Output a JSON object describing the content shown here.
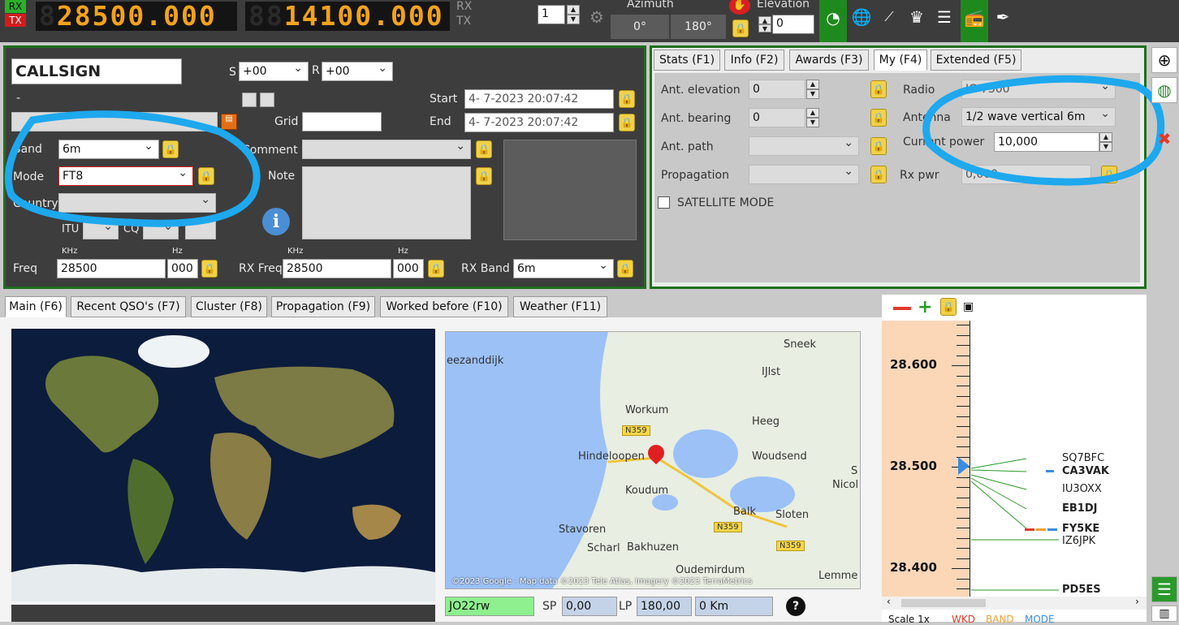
{
  "topbar": {
    "rx_tag": "RX",
    "tx_tag": "TX",
    "rx_freq": "28500.000",
    "tx_freq": "14100.000",
    "rx_label": "RX",
    "tx_label": "TX",
    "vfo_value": "1",
    "azimuth_label": "Azimuth",
    "azimuth_values": [
      "0°",
      "180°"
    ],
    "elevation_label": "Elevation",
    "elevation_value": "0"
  },
  "qso": {
    "callsign": "CALLSIGN",
    "s_label": "S",
    "s_value": "+00",
    "r_label": "R",
    "r_value": "+00",
    "dash": "-",
    "start_label": "Start",
    "start_value": "4- 7-2023 20:07:42",
    "end_label": "End",
    "end_value": "4- 7-2023 20:07:42",
    "grid_label": "Grid",
    "band_label": "Band",
    "band_value": "6m",
    "mode_label": "Mode",
    "mode_value": "FT8",
    "comment_label": "Comment",
    "note_label": "Note",
    "country_label": "Country",
    "itu_label": "ITU",
    "cq_label": "CQ",
    "khz_label": "KHz",
    "hz_label": "Hz",
    "freq_label": "Freq",
    "freq_khz": "28500",
    "freq_hz": "000",
    "rxfreq_label": "RX Freq",
    "rxfreq_khz": "28500",
    "rxfreq_hz": "000",
    "rxband_label": "RX Band",
    "rxband_value": "6m"
  },
  "my_tabs": [
    "Stats (F1)",
    "Info (F2)",
    "Awards (F3)",
    "My (F4)",
    "Extended (F5)"
  ],
  "my_panel": {
    "ant_elevation_label": "Ant. elevation",
    "ant_elevation_value": "0",
    "ant_bearing_label": "Ant. bearing",
    "ant_bearing_value": "0",
    "ant_path_label": "Ant. path",
    "propagation_label": "Propagation",
    "satellite_label": "SATELLITE MODE",
    "radio_label": "Radio",
    "radio_value": "IC-7300",
    "antenna_label": "Antenna",
    "antenna_value": "1/2 wave vertical 6m",
    "current_power_label": "Current power",
    "current_power_value": "10,000",
    "rx_pwr_label": "Rx pwr",
    "rx_pwr_value": "0,000"
  },
  "main_tabs": [
    "Main (F6)",
    "Recent QSO's (F7)",
    "Cluster (F8)",
    "Propagation (F9)",
    "Worked before (F10)",
    "Weather (F11)"
  ],
  "map": {
    "places": [
      "Sneek",
      "IJlst",
      "Workum",
      "Heeg",
      "Hindeloopen",
      "Woudsend",
      "Koudum",
      "Balk",
      "Sloten",
      "Stavoren",
      "Scharl",
      "Bakhuzen",
      "Oudemirdum",
      "Lemme",
      "Nicol",
      "eezanddijk",
      "S"
    ],
    "roads": [
      "N359",
      "N359",
      "N359"
    ],
    "copyright": "©2023 Google - Map data ©2023 Tele Atlas, Imagery ©2023 TerraMetrics",
    "locator": "JO22rw",
    "sp_label": "SP",
    "sp_value": "0,00",
    "lp_label": "LP",
    "lp_value": "180,00",
    "distance": "0 Km"
  },
  "bandmap": {
    "freqs": [
      "28.600",
      "28.500",
      "28.400"
    ],
    "spots": [
      "SQ7BFC",
      "CA3VAK",
      "IU3OXX",
      "EB1DJ",
      "FY5KE",
      "IZ6JPK",
      "PD5ES"
    ],
    "footer": "Scale 1x",
    "legend": [
      "WKD",
      "BAND",
      "MODE"
    ]
  },
  "colors": {
    "accent_green": "#1e6f1e",
    "led_orange": "#f3a21c",
    "annotation_blue": "#1ea8ee"
  }
}
